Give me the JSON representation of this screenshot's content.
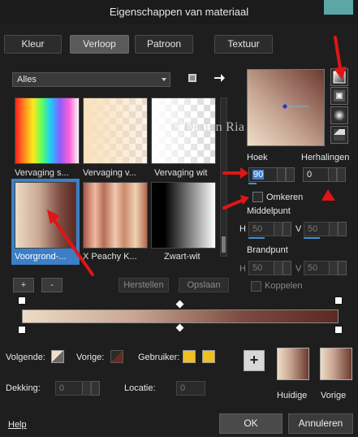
{
  "window": {
    "title": "Eigenschappen van materiaal"
  },
  "tabs": [
    {
      "label": "Kleur",
      "active": false
    },
    {
      "label": "Verloop",
      "active": true
    },
    {
      "label": "Patroon",
      "active": false
    },
    {
      "label": "Textuur",
      "active": false
    }
  ],
  "library": {
    "category": "Alles",
    "swatches": [
      {
        "label": "Vervaging s...",
        "selected": false
      },
      {
        "label": "Vervaging v...",
        "selected": false
      },
      {
        "label": "Vervaging wit",
        "selected": false
      },
      {
        "label": "Voorgrond-...",
        "selected": true
      },
      {
        "label": "X Peachy K...",
        "selected": false
      },
      {
        "label": "Zwart-wit",
        "selected": false
      }
    ],
    "add_label": "+",
    "remove_label": "-",
    "reset_label": "Herstellen",
    "save_label": "Opslaan"
  },
  "gradient": {
    "angle_label": "Hoek",
    "angle_value": "90",
    "angle_fill": 0.25,
    "repeats_label": "Herhalingen",
    "repeats_value": "0",
    "invert_label": "Omkeren",
    "invert_checked": false,
    "center_label": "Middelpunt",
    "center_h_label": "H",
    "center_h_value": "50",
    "center_h_fill": 0.5,
    "center_v_label": "V",
    "center_v_value": "50",
    "center_v_fill": 0.5,
    "focal_label": "Brandpunt",
    "focal_h_label": "H",
    "focal_h_value": "50",
    "focal_v_label": "V",
    "focal_v_value": "50",
    "link_label": "Koppelen",
    "link_checked": false
  },
  "stops": {
    "next_label": "Volgende:",
    "previous_label": "Vorige:",
    "user_label": "Gebruiker:",
    "user_color_1": "#f0c020",
    "user_color_2": "#f0c020",
    "opacity_label": "Dekking:",
    "opacity_value": "0",
    "location_label": "Locatie:",
    "location_value": "0"
  },
  "current": {
    "add_label": "+",
    "current_label": "Huidige",
    "previous_label": "Vorige"
  },
  "footer": {
    "help_label": "Help",
    "ok_label": "OK",
    "cancel_label": "Annuleren"
  },
  "watermark": {
    "text": "© Design Ria"
  },
  "colors": {
    "accent": "#3c7fc6",
    "arrow": "#e01515",
    "background": "#1e1e1e",
    "gradient_light": "#eddcc6",
    "gradient_dark": "#5a2a22"
  }
}
